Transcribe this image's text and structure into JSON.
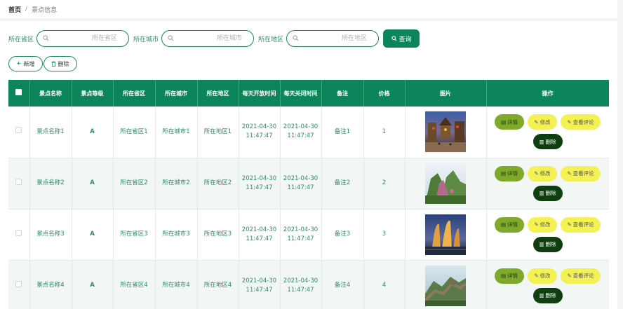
{
  "breadcrumb": {
    "home": "首页",
    "separator": "/",
    "current": "景点信息"
  },
  "search": {
    "fields": [
      {
        "label": "所在省区",
        "placeholder": "所在省区"
      },
      {
        "label": "所在城市",
        "placeholder": "所在城市"
      },
      {
        "label": "所在地区",
        "placeholder": "所在地区"
      }
    ],
    "query_label": "查询"
  },
  "actions": {
    "add_label": "新增",
    "delete_label": "删除"
  },
  "table": {
    "headers": [
      "景点名称",
      "景点等级",
      "所在省区",
      "所在城市",
      "所在地区",
      "每天开放时间",
      "每天关闭时间",
      "备注",
      "价格",
      "图片",
      "操作"
    ],
    "op_labels": {
      "detail": "详情",
      "edit": "修改",
      "review": "查看评论",
      "delete": "删除"
    },
    "rows": [
      {
        "name": "景点名称1",
        "grade": "A",
        "province": "所在省区1",
        "city": "所在城市1",
        "district": "所在地区1",
        "open_date": "2021-04-30",
        "open_time": "11:47:47",
        "close_date": "2021-04-30",
        "close_time": "11:47:47",
        "note": "备注1",
        "price": "1"
      },
      {
        "name": "景点名称2",
        "grade": "A",
        "province": "所在省区2",
        "city": "所在城市2",
        "district": "所在地区2",
        "open_date": "2021-04-30",
        "open_time": "11:47:47",
        "close_date": "2021-04-30",
        "close_time": "11:47:47",
        "note": "备注2",
        "price": "2"
      },
      {
        "name": "景点名称3",
        "grade": "A",
        "province": "所在省区3",
        "city": "所在城市3",
        "district": "所在地区3",
        "open_date": "2021-04-30",
        "open_time": "11:47:47",
        "close_date": "2021-04-30",
        "close_time": "11:47:47",
        "note": "备注3",
        "price": "3"
      },
      {
        "name": "景点名称4",
        "grade": "A",
        "province": "所在省区4",
        "city": "所在城市4",
        "district": "所在地区4",
        "open_date": "2021-04-30",
        "open_time": "11:47:47",
        "close_date": "2021-04-30",
        "close_time": "11:47:47",
        "note": "备注4",
        "price": "4"
      }
    ]
  },
  "colors": {
    "primary": "#0b8559",
    "text_green": "#2e8b63",
    "detail_btn": "#7ea92a",
    "yellow_btn": "#f4f154",
    "delete_btn": "#0f3f10"
  },
  "icons": {
    "search": "magnifier-icon",
    "add": "plus-icon",
    "delete": "trash-icon",
    "detail": "document-icon",
    "edit": "pencil-icon"
  }
}
